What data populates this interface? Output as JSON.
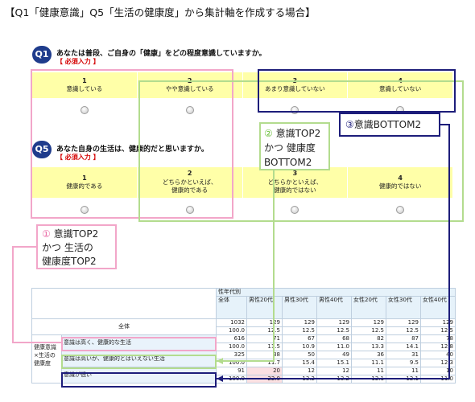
{
  "title": "【Q1「健康意識」Q5「生活の健康度」から集計軸を作成する場合】",
  "q1": {
    "badge": "Q1",
    "question": "あなたは普段、ご自身の「健康」をどの程度意識していますか。",
    "required": "【 必須入力 】",
    "options": [
      {
        "num": "1",
        "line1": "意識している",
        "line2": ""
      },
      {
        "num": "2",
        "line1": "やや意識している",
        "line2": ""
      },
      {
        "num": "3",
        "line1": "あまり意識していない",
        "line2": ""
      },
      {
        "num": "4",
        "line1": "意識していない",
        "line2": ""
      }
    ]
  },
  "q5": {
    "badge": "Q5",
    "question": "あなた自身の生活は、健康的だと思いますか。",
    "required": "【 必須入力 】",
    "options": [
      {
        "num": "1",
        "line1": "健康的である",
        "line2": ""
      },
      {
        "num": "2",
        "line1": "どちらかといえば、",
        "line2": "健康的である"
      },
      {
        "num": "3",
        "line1": "どちらかといえば、",
        "line2": "健康的ではない"
      },
      {
        "num": "4",
        "line1": "健康的ではない",
        "line2": ""
      }
    ]
  },
  "labels": {
    "one_num": "①",
    "one_line1": "意識TOP2",
    "one_line2": "かつ 生活の",
    "one_line3": "健康度TOP2",
    "two_num": "②",
    "two_line1": "意識TOP2",
    "two_line2": "かつ 健康度",
    "two_line3": "BOTTOM2",
    "three_num": "③",
    "three_line1": "意識BOTTOM2"
  },
  "colors": {
    "pink": "#f2a6c9",
    "green": "#b3dc8e",
    "navy": "#1d1d7a",
    "option_bg": "#ffffa8",
    "badge": "#1f3c8c"
  },
  "table": {
    "group_header": "性年代別",
    "columns": [
      "全体",
      "男性20代",
      "男性30代",
      "男性40代",
      "女性20代",
      "女性30代",
      "女性40代"
    ],
    "total_label": "全体",
    "side_label": "健康意識×生活の健康度",
    "rows": [
      {
        "label": "全体",
        "n": [
          "1032",
          "129",
          "129",
          "129",
          "129",
          "129",
          "129"
        ],
        "pct": [
          "100.0",
          "12.5",
          "12.5",
          "12.5",
          "12.5",
          "12.5",
          "12.5"
        ]
      },
      {
        "label": "意識は高く、健康的な生活",
        "n": [
          "616",
          "71",
          "67",
          "68",
          "82",
          "87",
          "78"
        ],
        "pct": [
          "100.0",
          "11.5",
          "10.9",
          "11.0",
          "13.3",
          "14.1",
          "12.8"
        ]
      },
      {
        "label": "意識は高いが、健康的とはいえない生活",
        "n": [
          "325",
          "38",
          "50",
          "49",
          "36",
          "31",
          "40"
        ],
        "pct": [
          "100.0",
          "11.7",
          "15.4",
          "15.1",
          "11.1",
          "9.5",
          "12.3"
        ]
      },
      {
        "label": "意識が低い",
        "n": [
          "91",
          "20",
          "12",
          "12",
          "11",
          "11",
          "10"
        ],
        "pct": [
          "100.0",
          "22.0",
          "13.2",
          "13.2",
          "12.1",
          "12.1",
          "11.0"
        ]
      }
    ]
  }
}
